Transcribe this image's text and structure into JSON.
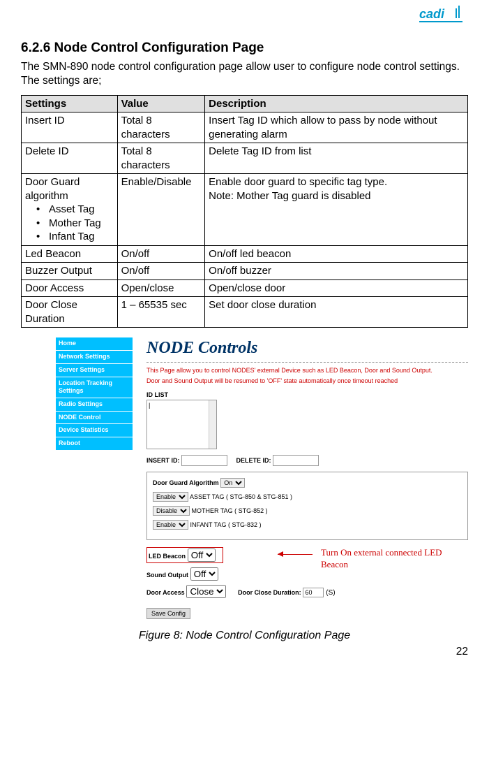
{
  "brand": "cadi",
  "section": {
    "number": "6.2.6",
    "title": "Node Control Configuration Page",
    "intro": "The SMN-890 node control configuration page allow user to configure node control settings. The settings are;"
  },
  "table": {
    "headers": [
      "Settings",
      "Value",
      "Description"
    ],
    "rows": [
      {
        "setting": "Insert ID",
        "value": "Total 8 characters",
        "desc": "Insert Tag ID which allow to pass by node without generating alarm"
      },
      {
        "setting": "Delete ID",
        "value": "Total 8 characters",
        "desc": "Delete Tag ID from list"
      },
      {
        "setting_main": "Door Guard algorithm",
        "setting_items": [
          "Asset Tag",
          "Mother Tag",
          "Infant Tag"
        ],
        "value": "Enable/Disable",
        "desc": "Enable door guard to specific tag type.\nNote: Mother Tag guard is disabled"
      },
      {
        "setting": "Led Beacon",
        "value": "On/off",
        "desc": "On/off led beacon"
      },
      {
        "setting": "Buzzer Output",
        "value": "On/off",
        "desc": "On/off buzzer"
      },
      {
        "setting": "Door Access",
        "value": "Open/close",
        "desc": "Open/close door"
      },
      {
        "setting": "Door Close Duration",
        "value": "1 – 65535 sec",
        "desc": "Set door close duration"
      }
    ]
  },
  "sidebar": [
    "Home",
    "Network Settings",
    "Server Settings",
    "Location Tracking Settings",
    "Radio Settings",
    "NODE Control",
    "Device Statistics",
    "Reboot"
  ],
  "screenshot": {
    "title": "NODE Controls",
    "desc1": "This Page allow you to control NODES' external Device such as LED Beacon, Door and Sound Output.",
    "desc2": "Door and Sound Output will be resumed to 'OFF' state automatically once timeout reached",
    "idlist_label": "ID LIST",
    "idlist_content": "|",
    "insert_id_label": "INSERT ID:",
    "delete_id_label": "DELETE ID:",
    "panel": {
      "title": "Door Guard Algorithm",
      "main_sel": "On",
      "rows": [
        {
          "sel": "Enable",
          "txt": "ASSET TAG   ( STG-850  &  STG-851 )"
        },
        {
          "sel": "Disable",
          "txt": "MOTHER TAG  ( STG-852 )"
        },
        {
          "sel": "Enable",
          "txt": "INFANT TAG  ( STG-832 )"
        }
      ]
    },
    "controls": {
      "led_label": "LED Beacon",
      "led_val": "Off",
      "sound_label": "Sound Output",
      "sound_val": "Off",
      "door_label": "Door Access",
      "door_val": "Close",
      "dur_label": "Door Close  Duration:",
      "dur_val": "60",
      "dur_unit": "(S)"
    },
    "save": "Save Config",
    "callout": "Turn On external connected LED Beacon"
  },
  "caption": "Figure 8: Node Control Configuration Page",
  "page": "22"
}
